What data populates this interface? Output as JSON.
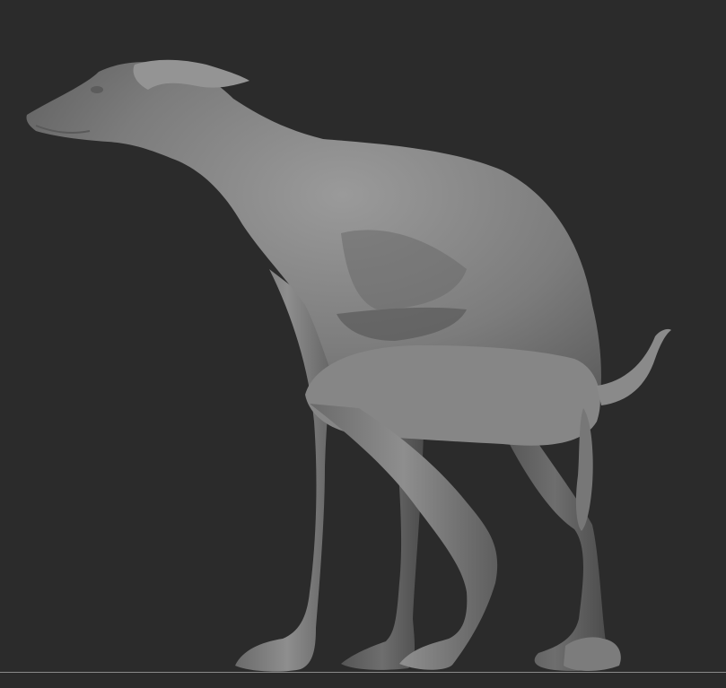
{
  "scene": {
    "background_color": "#2b2b2b",
    "model_color": "#7a7a7a",
    "ground_line_color": "#8a8a8a"
  }
}
